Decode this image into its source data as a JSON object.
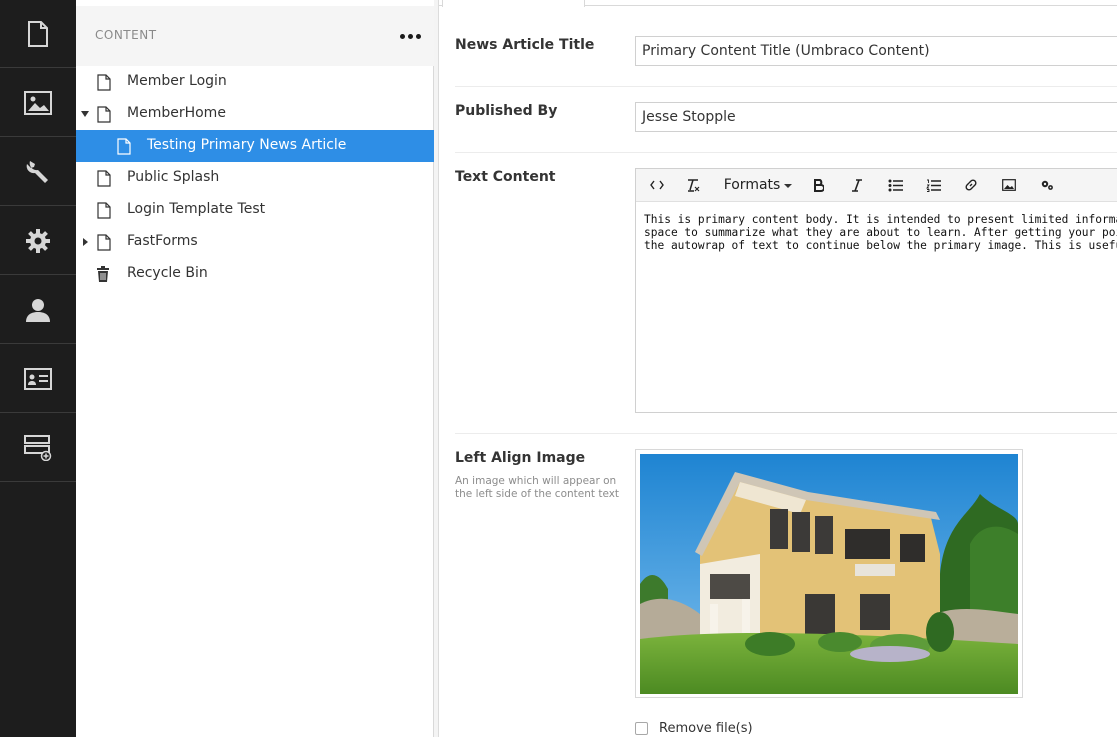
{
  "rail": {
    "items": [
      {
        "icon": "content-icon"
      },
      {
        "icon": "media-icon"
      },
      {
        "icon": "wrench-icon"
      },
      {
        "icon": "gear-icon"
      },
      {
        "icon": "member-icon"
      },
      {
        "icon": "form-icon"
      },
      {
        "icon": "deploy-icon"
      }
    ]
  },
  "tree": {
    "title": "CONTENT",
    "nodes": [
      {
        "label": "Member Login",
        "icon": "document-icon",
        "expanded": false,
        "selected": false
      },
      {
        "label": "MemberHome",
        "icon": "document-icon",
        "expanded": true,
        "selected": false
      },
      {
        "label": "Testing Primary News Article",
        "icon": "document-icon",
        "expanded": false,
        "selected": true
      },
      {
        "label": "Public Splash",
        "icon": "document-icon",
        "expanded": false,
        "selected": false
      },
      {
        "label": "Login Template Test",
        "icon": "document-icon",
        "expanded": false,
        "selected": false
      },
      {
        "label": "FastForms",
        "icon": "document-icon",
        "expanded": false,
        "selected": false
      },
      {
        "label": "Recycle Bin",
        "icon": "trash-icon",
        "expanded": false,
        "selected": false
      }
    ]
  },
  "editor": {
    "fields": {
      "title": {
        "label": "News Article Title",
        "value": "Primary Content Title (Umbraco Content)"
      },
      "published_by": {
        "label": "Published By",
        "value": "Jesse Stopple"
      },
      "text_content": {
        "label": "Text Content",
        "toolbar": {
          "formats_label": "Formats"
        },
        "body_lines": [
          "This is primary content body. It is intended to present limited information, or prese",
          "space to summarize what they are about to learn. After getting your point across,",
          "the autowrap of text to continue below the primary image. This is useful in situation"
        ]
      },
      "left_image": {
        "label": "Left Align Image",
        "description": "An image which will appear on the left side of the content text",
        "remove_label": "Remove file(s)"
      }
    }
  },
  "colors": {
    "rail_bg": "#1d1d1d",
    "selected_node": "#2e8ee6",
    "tree_header_bg": "#f5f5f5"
  }
}
